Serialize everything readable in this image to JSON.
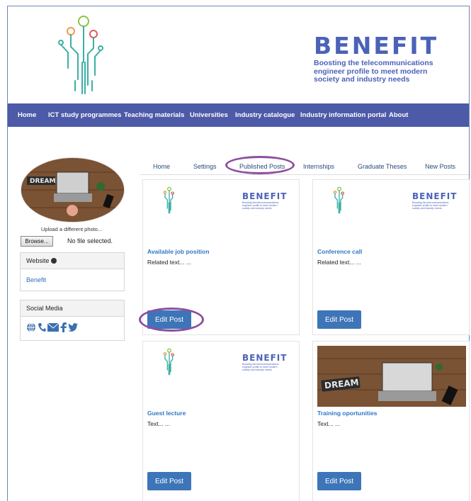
{
  "brand": {
    "name": "BENEFIT",
    "tagline": [
      "Boosting the telecommunications",
      "engineer profile to meet modern",
      "society and industry needs"
    ]
  },
  "nav": [
    "Home",
    "ICT study programmes",
    "Teaching materials",
    "Universities",
    "Industry catalogue",
    "Industry information portal",
    "About"
  ],
  "profile": {
    "avatar_text": "DREAM",
    "upload_label": "Upload a different photo...",
    "browse_label": "Browse...",
    "file_status": "No file selected.",
    "website_label": "Website",
    "website_link": "Benefit",
    "social_label": "Social Media",
    "social_icons": [
      "globe-icon",
      "phone-icon",
      "mail-icon",
      "facebook-icon",
      "twitter-icon"
    ]
  },
  "tabs": [
    "Home",
    "Settings",
    "Published Posts",
    "Internships",
    "Graduate Theses",
    "New Posts"
  ],
  "active_tab": "Published Posts",
  "posts": [
    {
      "title": "Available job position",
      "text": "Related text... ...",
      "button": "Edit Post",
      "image": "benefit-logo"
    },
    {
      "title": "Conference call",
      "text": "Related text... ...",
      "button": "Edit Post",
      "image": "benefit-logo"
    },
    {
      "title": "Guest lecture",
      "text": "Text... ...",
      "button": "Edit Post",
      "image": "benefit-logo"
    },
    {
      "title": "Training oportunities",
      "text": "Text... ...",
      "button": "Edit Post",
      "image": "dream-laptop-photo"
    }
  ],
  "colors": {
    "nav": "#4d5aa8",
    "brand": "#4b62b8",
    "button": "#3d75b8",
    "highlight": "#8d4fa0",
    "title_link": "#2f77c6"
  }
}
